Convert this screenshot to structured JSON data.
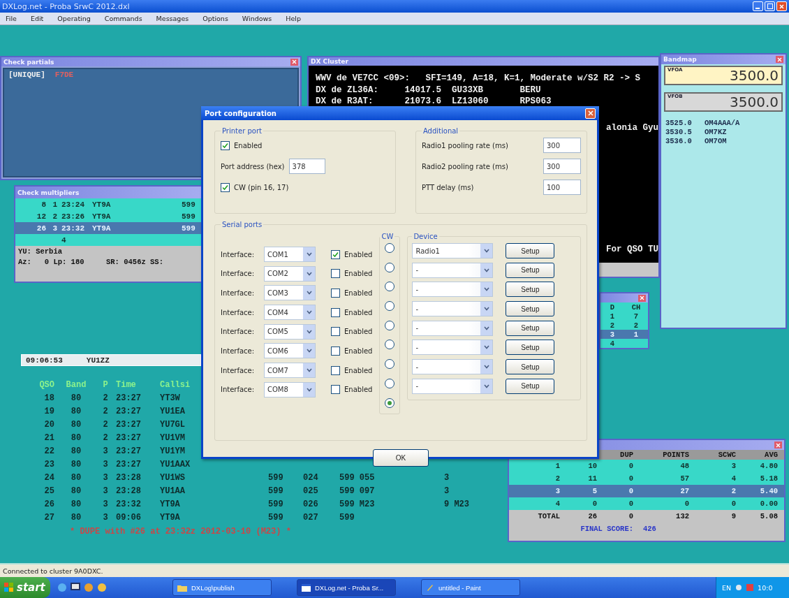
{
  "window": {
    "title": "DXLog.net - Proba SrwC 2012.dxl"
  },
  "menu": [
    "File",
    "Edit",
    "Operating",
    "Commands",
    "Messages",
    "Options",
    "Windows",
    "Help"
  ],
  "check_partials": {
    "title": "Check partials",
    "entries": [
      {
        "text": "[UNIQUE]",
        "kind": "label"
      },
      {
        "text": "F7DE",
        "kind": "partial"
      }
    ]
  },
  "check_multipliers": {
    "title": "Check multipliers",
    "rows": [
      {
        "cells": [
          "8",
          "1",
          "23:24",
          "YT9A",
          "599"
        ],
        "selected": false
      },
      {
        "cells": [
          "12",
          "2",
          "23:26",
          "YT9A",
          "599"
        ],
        "selected": false
      },
      {
        "cells": [
          "26",
          "3",
          "23:32",
          "YT9A",
          "599"
        ],
        "selected": true
      },
      {
        "cells": [
          "",
          "",
          "4"
        ],
        "selected": false
      }
    ],
    "info": [
      "YU: Serbia",
      "Az:   0 Lp: 180     SR: 0456z SS:"
    ]
  },
  "entry": {
    "time": "09:06:53",
    "call": "YU1ZZ"
  },
  "log": {
    "columns": [
      "QSO",
      "Band",
      "P",
      "Time",
      "Callsi"
    ],
    "rows": [
      {
        "qso": "18",
        "band": "80",
        "p": "2",
        "time": "23:27",
        "call": "YT3W"
      },
      {
        "qso": "19",
        "band": "80",
        "p": "2",
        "time": "23:27",
        "call": "YU1EA"
      },
      {
        "qso": "20",
        "band": "80",
        "p": "2",
        "time": "23:27",
        "call": "YU7GL"
      },
      {
        "qso": "21",
        "band": "80",
        "p": "2",
        "time": "23:27",
        "call": "YU1VM"
      },
      {
        "qso": "22",
        "band": "80",
        "p": "3",
        "time": "23:27",
        "call": "YU1YM"
      },
      {
        "qso": "23",
        "band": "80",
        "p": "3",
        "time": "23:27",
        "call": "YU1AAX"
      },
      {
        "qso": "24",
        "band": "80",
        "p": "3",
        "time": "23:28",
        "call": "YU1WS",
        "rst": "599",
        "nr": "024",
        "rcvd": "599 055",
        "mult": "3"
      },
      {
        "qso": "25",
        "band": "80",
        "p": "3",
        "time": "23:28",
        "call": "YU1AA",
        "rst": "599",
        "nr": "025",
        "rcvd": "599 097",
        "mult": "3"
      },
      {
        "qso": "26",
        "band": "80",
        "p": "3",
        "time": "23:32",
        "call": "YT9A",
        "rst": "599",
        "nr": "026",
        "rcvd": "599 M23",
        "mult": "9 M23"
      },
      {
        "qso": "27",
        "band": "80",
        "p": "3",
        "time": "09:06",
        "call": "YT9A",
        "rst": "599",
        "nr": "027",
        "rcvd": "599"
      }
    ],
    "message": "* DUPE with #26 at 23:32z 2012-03-10 (M23) *"
  },
  "dx_cluster": {
    "title": "DX Cluster",
    "lines": [
      "WWV de VE7CC <09>:   SFI=149, A=18, K=1, Moderate w/S2 R2 -> S",
      "DX de ZL36A:     14017.5  GU33XB       BERU",
      "DX de R3AT:      21073.6  LZ13060      RPS063"
    ],
    "tails": [
      "alonia Gyu",
      "For QSO TU"
    ]
  },
  "bandmap": {
    "title": "Bandmap",
    "vfos": [
      {
        "label": "VFOA",
        "freq": "3500.0",
        "selected": true
      },
      {
        "label": "VFOB",
        "freq": "3500.0",
        "selected": false
      }
    ],
    "spots": [
      {
        "freq": "3525.0",
        "call": "OM4AAA/A"
      },
      {
        "freq": "3530.5",
        "call": "OM7KZ"
      },
      {
        "freq": "3536.0",
        "call": "OM7OM"
      }
    ]
  },
  "small_window": {
    "header": [
      "D",
      "CH"
    ],
    "rows": [
      {
        "cells": [
          "1",
          "7"
        ],
        "selected": false
      },
      {
        "cells": [
          "2",
          "2"
        ],
        "selected": false
      },
      {
        "cells": [
          "3",
          "1"
        ],
        "selected": true
      },
      {
        "cells": [
          "4"
        ],
        "selected": false
      }
    ]
  },
  "score": {
    "header": [
      "DUP",
      "POINTS",
      "SCWC",
      "AVG"
    ],
    "rows": [
      {
        "cells": [
          "1",
          "10",
          "0",
          "48",
          "3",
          "4.80"
        ],
        "selected": false
      },
      {
        "cells": [
          "2",
          "11",
          "0",
          "57",
          "4",
          "5.18"
        ],
        "selected": false
      },
      {
        "cells": [
          "3",
          "5",
          "0",
          "27",
          "2",
          "5.40"
        ],
        "selected": true
      },
      {
        "cells": [
          "4",
          "0",
          "0",
          "0",
          "0",
          "0.00"
        ],
        "selected": false
      }
    ],
    "total": [
      "TOTAL",
      "26",
      "0",
      "132",
      "9",
      "5.08"
    ],
    "final_label": "FINAL SCORE:",
    "final_value": "426"
  },
  "dialog": {
    "title": "Port configuration",
    "printer_port": {
      "title": "Printer port",
      "enabled_label": "Enabled",
      "enabled": true,
      "address_label": "Port address (hex)",
      "address": "378",
      "cw_label": "CW (pin 16, 17)",
      "cw": true
    },
    "additional": {
      "title": "Additional",
      "fields": [
        {
          "label": "Radio1 pooling rate (ms)",
          "value": "300"
        },
        {
          "label": "Radio2 pooling rate (ms)",
          "value": "300"
        },
        {
          "label": "PTT delay (ms)",
          "value": "100"
        }
      ]
    },
    "serial_ports": {
      "title": "Serial ports",
      "cw_title": "CW",
      "device_title": "Device",
      "ports": [
        {
          "label": "Interface:",
          "port": "COM1",
          "enabled_label": "Enabled",
          "enabled": true,
          "device": "Radio1",
          "setup": "Setup"
        },
        {
          "label": "Interface:",
          "port": "COM2",
          "enabled_label": "Enabled",
          "enabled": false,
          "device": "-",
          "setup": "Setup"
        },
        {
          "label": "Interface:",
          "port": "COM3",
          "enabled_label": "Enabled",
          "enabled": false,
          "device": "-",
          "setup": "Setup"
        },
        {
          "label": "Interface:",
          "port": "COM4",
          "enabled_label": "Enabled",
          "enabled": false,
          "device": "-",
          "setup": "Setup"
        },
        {
          "label": "Interface:",
          "port": "COM5",
          "enabled_label": "Enabled",
          "enabled": false,
          "device": "-",
          "setup": "Setup"
        },
        {
          "label": "Interface:",
          "port": "COM6",
          "enabled_label": "Enabled",
          "enabled": false,
          "device": "-",
          "setup": "Setup"
        },
        {
          "label": "Interface:",
          "port": "COM7",
          "enabled_label": "Enabled",
          "enabled": false,
          "device": "-",
          "setup": "Setup"
        },
        {
          "label": "Interface:",
          "port": "COM8",
          "enabled_label": "Enabled",
          "enabled": false,
          "device": "-",
          "setup": "Setup"
        }
      ],
      "cw_options": [
        {
          "selected": false
        },
        {
          "selected": false
        },
        {
          "selected": false
        },
        {
          "selected": false
        },
        {
          "selected": false
        },
        {
          "selected": false
        },
        {
          "selected": false
        },
        {
          "selected": false
        },
        {
          "selected": true
        }
      ]
    },
    "ok": "OK"
  },
  "status_bar": "Connected to cluster 9A0DXC.",
  "taskbar": {
    "start": "start",
    "tasks": [
      {
        "label": "DXLog\\publish",
        "kind": "folder",
        "selected": false
      },
      {
        "label": "DXLog.net - Proba Sr...",
        "kind": "app",
        "selected": true
      },
      {
        "label": "untitled - Paint",
        "kind": "paint",
        "selected": false
      }
    ],
    "language": "EN",
    "clock": "10:0"
  }
}
